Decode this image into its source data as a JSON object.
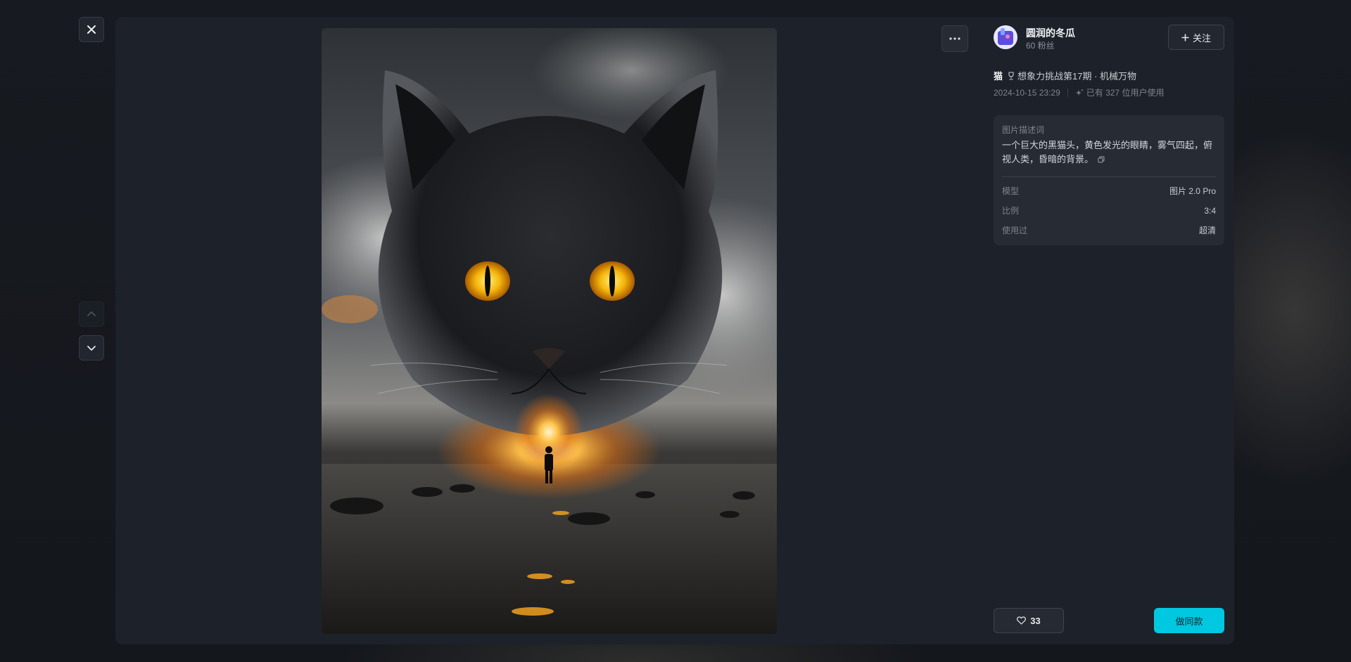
{
  "author": {
    "name": "圆润的冬瓜",
    "fans": "60 粉丝",
    "follow_label": "关注"
  },
  "post": {
    "category": "猫",
    "activity": "想象力挑战第17期 · 机械万物",
    "date": "2024-10-15 23:29",
    "usage": "已有 327 位用户使用"
  },
  "prompt": {
    "title": "图片描述词",
    "text": "一个巨大的黑猫头，黄色发光的眼睛，雾气四起，俯视人类，昏暗的背景。"
  },
  "details": [
    {
      "key": "模型",
      "value": "图片 2.0 Pro"
    },
    {
      "key": "比例",
      "value": "3:4"
    },
    {
      "key": "使用过",
      "value": "超清"
    }
  ],
  "actions": {
    "likes": "33",
    "make_same_label": "做同款"
  },
  "colors": {
    "accent": "#00c8e0",
    "panel_bg": "#1d2129",
    "card_bg": "#272b34"
  },
  "icons": {
    "close": "close-icon",
    "up": "chevron-up-icon",
    "down": "chevron-down-icon",
    "more": "more-icon",
    "plus": "plus-icon",
    "trophy": "trophy-icon",
    "sparkle": "sparkle-icon",
    "copy": "copy-icon",
    "heart": "heart-icon"
  }
}
